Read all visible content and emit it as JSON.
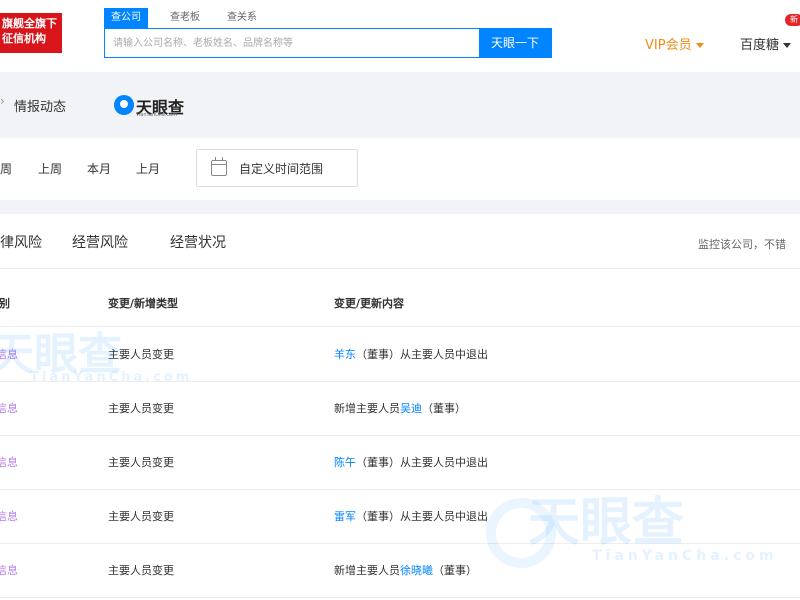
{
  "header": {
    "brand_badge": [
      "旗舰全旗下",
      "征信机构"
    ],
    "search_tabs": [
      "查公司",
      "查老板",
      "查关系"
    ],
    "search_placeholder": "请输入公司名称、老板姓名、品牌名称等",
    "search_button": "天眼一下",
    "vip_label": "VIP会员",
    "account_label": "百度糖",
    "new_badge": "新"
  },
  "breadcrumb": {
    "title": "情报动态",
    "logo_text": "天眼查",
    "logo_sub": "TianYanCha.com"
  },
  "time_filter": {
    "items": [
      "本周",
      "上周",
      "本月",
      "上月"
    ],
    "custom_label": "自定义时间范围"
  },
  "categories": {
    "tabs": [
      "法律风险",
      "经营风险",
      "经营状况"
    ],
    "monitor_tip": "监控该公司，不错"
  },
  "table": {
    "headers": [
      "类别",
      "变更/新增类型",
      "变更/更新内容"
    ],
    "rows": [
      {
        "tag": "信息",
        "type": "主要人员变更",
        "pre": "",
        "name": "羊东",
        "post": "（董事）从主要人员中退出"
      },
      {
        "tag": "信息",
        "type": "主要人员变更",
        "pre": "新增主要人员",
        "name": "吴迪",
        "post": "（董事）"
      },
      {
        "tag": "信息",
        "type": "主要人员变更",
        "pre": "",
        "name": "陈午",
        "post": "（董事）从主要人员中退出"
      },
      {
        "tag": "信息",
        "type": "主要人员变更",
        "pre": "",
        "name": "雷军",
        "post": "（董事）从主要人员中退出"
      },
      {
        "tag": "信息",
        "type": "主要人员变更",
        "pre": "新增主要人员",
        "name": "徐晓曦",
        "post": "（董事）"
      }
    ]
  },
  "watermark": {
    "text": "天眼查",
    "sub": "TianYanCha.com"
  },
  "colors": {
    "accent": "#0084ff",
    "vip": "#f08c17",
    "brand_red": "#d7151b",
    "tag_purple": "#b57ee8"
  }
}
